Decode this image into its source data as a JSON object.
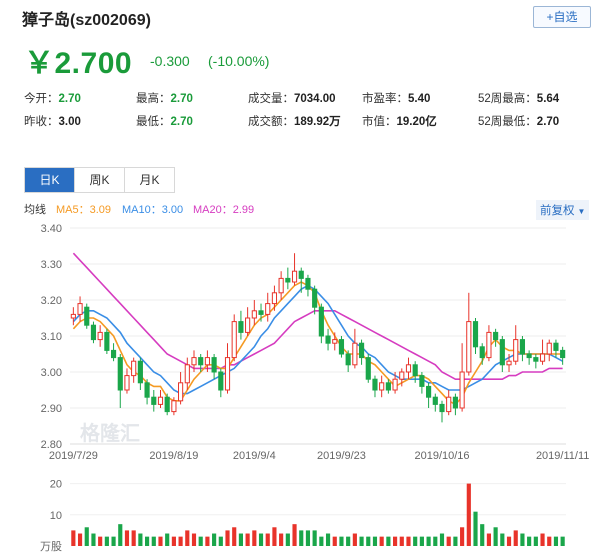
{
  "header": {
    "title": "獐子岛(sz002069)",
    "follow_label": "+自选",
    "price": "￥2.700",
    "change": "-0.300",
    "change_pct": "(-10.00%)"
  },
  "stats": [
    {
      "label": "今开：",
      "value": "2.70",
      "green": true
    },
    {
      "label": "最高：",
      "value": "2.70",
      "green": true
    },
    {
      "label": "成交量：",
      "value": "7034.00",
      "green": false
    },
    {
      "label": "市盈率：",
      "value": "5.40",
      "green": false
    },
    {
      "label": "52周最高：",
      "value": "5.64",
      "green": false
    },
    {
      "label": "昨收：",
      "value": "3.00",
      "green": false
    },
    {
      "label": "最低：",
      "value": "2.70",
      "green": true
    },
    {
      "label": "成交额：",
      "value": "189.92万",
      "green": false
    },
    {
      "label": "市值：",
      "value": "19.20亿",
      "green": false
    },
    {
      "label": "52周最低：",
      "value": "2.70",
      "green": false
    }
  ],
  "tabs": [
    {
      "label": "日K",
      "active": true
    },
    {
      "label": "周K",
      "active": false
    },
    {
      "label": "月K",
      "active": false
    }
  ],
  "legend": {
    "ma_label": "均线",
    "ma5": "MA5：3.09",
    "ma10": "MA10：3.00",
    "ma20": "MA20：2.99"
  },
  "adjust_label": "前复权",
  "watermark": "格隆汇",
  "colors": {
    "up": "#e8332a",
    "down": "#1aa64a",
    "ma5": "#f59a23",
    "ma10": "#3a8ee6",
    "ma20": "#d63cc0",
    "accent": "#2a6ec2"
  },
  "chart_data": {
    "type": "candlestick",
    "y_ticks": [
      "3.40",
      "3.30",
      "3.20",
      "3.10",
      "3.00",
      "2.90",
      "2.80"
    ],
    "ylim": [
      2.8,
      3.4
    ],
    "x_ticks": [
      "2019/7/29",
      "2019/8/19",
      "2019/9/4",
      "2019/9/23",
      "2019/10/16",
      "2019/11/11"
    ],
    "x_tick_index": [
      0,
      15,
      27,
      40,
      55,
      73
    ],
    "volume_label": "万股",
    "volume_ticks": [
      "20",
      "10"
    ],
    "volume_ylim": [
      0,
      25
    ],
    "candles": [
      [
        3.15,
        3.16,
        3.13,
        3.18
      ],
      [
        3.16,
        3.19,
        3.14,
        3.21
      ],
      [
        3.18,
        3.13,
        3.12,
        3.19
      ],
      [
        3.13,
        3.09,
        3.08,
        3.14
      ],
      [
        3.09,
        3.11,
        3.07,
        3.13
      ],
      [
        3.11,
        3.06,
        3.05,
        3.12
      ],
      [
        3.06,
        3.04,
        3.03,
        3.08
      ],
      [
        3.04,
        2.95,
        2.9,
        3.05
      ],
      [
        2.95,
        2.99,
        2.94,
        3.01
      ],
      [
        2.99,
        3.03,
        2.97,
        3.04
      ],
      [
        3.03,
        2.97,
        2.95,
        3.04
      ],
      [
        2.97,
        2.93,
        2.91,
        2.98
      ],
      [
        2.93,
        2.91,
        2.89,
        2.95
      ],
      [
        2.91,
        2.93,
        2.9,
        2.95
      ],
      [
        2.93,
        2.89,
        2.88,
        2.94
      ],
      [
        2.89,
        2.92,
        2.88,
        2.93
      ],
      [
        2.92,
        2.97,
        2.91,
        3.0
      ],
      [
        2.97,
        3.02,
        2.95,
        3.04
      ],
      [
        3.02,
        3.04,
        3.0,
        3.06
      ],
      [
        3.04,
        3.02,
        3.0,
        3.05
      ],
      [
        3.02,
        3.04,
        3.0,
        3.06
      ],
      [
        3.04,
        3.0,
        2.98,
        3.05
      ],
      [
        3.0,
        2.95,
        2.93,
        3.01
      ],
      [
        2.95,
        3.04,
        2.94,
        3.08
      ],
      [
        3.04,
        3.14,
        3.03,
        3.16
      ],
      [
        3.14,
        3.11,
        3.09,
        3.17
      ],
      [
        3.11,
        3.15,
        3.1,
        3.18
      ],
      [
        3.15,
        3.17,
        3.13,
        3.2
      ],
      [
        3.17,
        3.16,
        3.14,
        3.19
      ],
      [
        3.16,
        3.19,
        3.14,
        3.22
      ],
      [
        3.19,
        3.22,
        3.17,
        3.24
      ],
      [
        3.22,
        3.26,
        3.2,
        3.28
      ],
      [
        3.26,
        3.25,
        3.23,
        3.29
      ],
      [
        3.25,
        3.28,
        3.24,
        3.33
      ],
      [
        3.28,
        3.26,
        3.22,
        3.29
      ],
      [
        3.26,
        3.23,
        3.21,
        3.27
      ],
      [
        3.23,
        3.18,
        3.16,
        3.24
      ],
      [
        3.18,
        3.1,
        3.08,
        3.19
      ],
      [
        3.1,
        3.08,
        3.06,
        3.12
      ],
      [
        3.08,
        3.09,
        3.06,
        3.11
      ],
      [
        3.09,
        3.05,
        3.04,
        3.1
      ],
      [
        3.05,
        3.02,
        3.0,
        3.06
      ],
      [
        3.02,
        3.08,
        3.01,
        3.12
      ],
      [
        3.08,
        3.04,
        3.02,
        3.09
      ],
      [
        3.04,
        2.98,
        2.97,
        3.05
      ],
      [
        2.98,
        2.95,
        2.93,
        2.99
      ],
      [
        2.95,
        2.97,
        2.93,
        2.99
      ],
      [
        2.97,
        2.95,
        2.94,
        2.98
      ],
      [
        2.95,
        2.98,
        2.94,
        3.0
      ],
      [
        2.98,
        3.0,
        2.96,
        3.01
      ],
      [
        3.0,
        3.02,
        2.98,
        3.04
      ],
      [
        3.02,
        2.99,
        2.97,
        3.03
      ],
      [
        2.99,
        2.96,
        2.94,
        3.0
      ],
      [
        2.96,
        2.93,
        2.9,
        2.97
      ],
      [
        2.93,
        2.91,
        2.89,
        2.94
      ],
      [
        2.91,
        2.89,
        2.86,
        2.92
      ],
      [
        2.89,
        2.93,
        2.88,
        2.95
      ],
      [
        2.93,
        2.9,
        2.88,
        2.94
      ],
      [
        2.9,
        3.0,
        2.89,
        3.08
      ],
      [
        3.0,
        3.14,
        2.99,
        3.22
      ],
      [
        3.14,
        3.07,
        3.05,
        3.15
      ],
      [
        3.07,
        3.04,
        3.02,
        3.08
      ],
      [
        3.04,
        3.11,
        3.03,
        3.13
      ],
      [
        3.11,
        3.09,
        3.07,
        3.12
      ],
      [
        3.09,
        3.02,
        3.0,
        3.1
      ],
      [
        3.02,
        3.03,
        3.0,
        3.05
      ],
      [
        3.03,
        3.09,
        3.02,
        3.13
      ],
      [
        3.09,
        3.05,
        3.03,
        3.1
      ],
      [
        3.05,
        3.04,
        3.02,
        3.06
      ],
      [
        3.04,
        3.03,
        3.01,
        3.05
      ],
      [
        3.03,
        3.05,
        3.02,
        3.09
      ],
      [
        3.05,
        3.08,
        3.03,
        3.09
      ],
      [
        3.08,
        3.06,
        3.04,
        3.09
      ],
      [
        3.06,
        3.04,
        3.02,
        3.07
      ]
    ],
    "volumes": [
      5,
      4,
      6,
      4,
      3,
      3,
      3,
      7,
      5,
      5,
      4,
      3,
      3,
      3,
      4,
      3,
      3,
      5,
      4,
      3,
      3,
      4,
      3,
      5,
      6,
      4,
      4,
      5,
      4,
      4,
      6,
      4,
      4,
      7,
      5,
      5,
      5,
      3,
      4,
      3,
      3,
      3,
      4,
      3,
      3,
      3,
      3,
      3,
      3,
      3,
      3,
      3,
      3,
      3,
      3,
      4,
      3,
      3,
      6,
      20,
      11,
      7,
      4,
      6,
      4,
      3,
      5,
      4,
      3,
      3,
      4,
      3,
      3,
      3
    ],
    "ma5": [
      3.12,
      3.14,
      3.15,
      3.15,
      3.14,
      3.12,
      3.1,
      3.06,
      3.02,
      3.0,
      2.99,
      2.97,
      2.96,
      2.96,
      2.93,
      2.92,
      2.92,
      2.95,
      2.98,
      3.0,
      3.02,
      3.02,
      3.01,
      3.01,
      3.04,
      3.07,
      3.1,
      3.13,
      3.15,
      3.16,
      3.18,
      3.2,
      3.22,
      3.24,
      3.25,
      3.24,
      3.22,
      3.17,
      3.13,
      3.1,
      3.07,
      3.05,
      3.05,
      3.05,
      3.03,
      3.02,
      3.0,
      2.98,
      2.96,
      2.97,
      2.98,
      2.99,
      2.99,
      2.98,
      2.96,
      2.94,
      2.92,
      2.91,
      2.93,
      2.97,
      3.0,
      3.03,
      3.07,
      3.09,
      3.07,
      3.06,
      3.06,
      3.05,
      3.05,
      3.05,
      3.05,
      3.05,
      3.05,
      3.05
    ],
    "ma10": [
      3.14,
      3.16,
      3.17,
      3.17,
      3.16,
      3.15,
      3.13,
      3.11,
      3.08,
      3.06,
      3.04,
      3.02,
      3.0,
      2.99,
      2.97,
      2.95,
      2.94,
      2.94,
      2.95,
      2.96,
      2.97,
      2.98,
      2.99,
      3.0,
      3.01,
      3.03,
      3.05,
      3.07,
      3.1,
      3.12,
      3.15,
      3.17,
      3.19,
      3.21,
      3.23,
      3.24,
      3.23,
      3.21,
      3.19,
      3.16,
      3.13,
      3.1,
      3.08,
      3.07,
      3.05,
      3.04,
      3.02,
      3.0,
      2.99,
      2.98,
      2.98,
      2.98,
      2.98,
      2.97,
      2.97,
      2.96,
      2.95,
      2.95,
      2.95,
      2.96,
      2.97,
      2.98,
      3.0,
      3.02,
      3.03,
      3.04,
      3.05,
      3.05,
      3.05,
      3.05,
      3.05,
      3.05,
      3.04,
      3.03
    ],
    "ma20": [
      3.33,
      3.31,
      3.29,
      3.27,
      3.25,
      3.23,
      3.21,
      3.19,
      3.17,
      3.15,
      3.13,
      3.11,
      3.09,
      3.07,
      3.05,
      3.04,
      3.03,
      3.02,
      3.01,
      3.01,
      3.01,
      3.01,
      3.01,
      3.02,
      3.02,
      3.03,
      3.04,
      3.05,
      3.06,
      3.07,
      3.08,
      3.1,
      3.12,
      3.14,
      3.15,
      3.16,
      3.17,
      3.17,
      3.17,
      3.17,
      3.16,
      3.15,
      3.14,
      3.13,
      3.12,
      3.11,
      3.1,
      3.09,
      3.08,
      3.07,
      3.06,
      3.05,
      3.04,
      3.03,
      3.02,
      3.0,
      2.99,
      2.98,
      2.98,
      2.98,
      2.98,
      2.98,
      2.98,
      2.98,
      2.98,
      2.99,
      2.99,
      3.0,
      3.0,
      3.0,
      3.0,
      3.01,
      3.01,
      3.01
    ]
  }
}
